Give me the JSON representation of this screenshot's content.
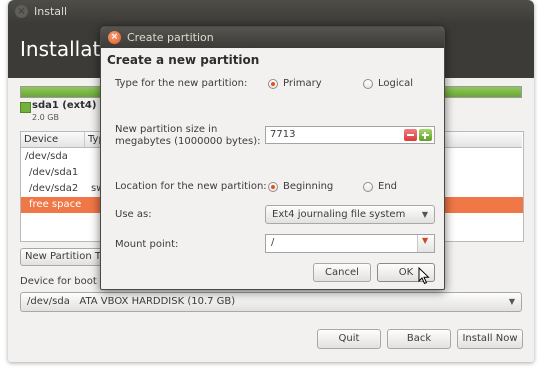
{
  "main_window": {
    "title": "Install",
    "heading": "Installation type",
    "disk": {
      "name": "sda1 (ext4)",
      "size": "2.0 GB",
      "used_fraction": 1.0
    },
    "table": {
      "columns": [
        "Device",
        "Type"
      ],
      "rows": [
        {
          "device": "/dev/sda",
          "type": ""
        },
        {
          "device": "/dev/sda1",
          "type": ""
        },
        {
          "device": "/dev/sda2",
          "type": "swap"
        },
        {
          "device": "free space",
          "type": "",
          "selected": true
        }
      ]
    },
    "new_partition_table_label": "New Partition Table...",
    "boot_loader_label": "Device for boot loader installation:",
    "boot_device": "/dev/sda   ATA VBOX HARDDISK (10.7 GB)",
    "buttons": {
      "quit": "Quit",
      "back": "Back",
      "install_now": "Install Now"
    }
  },
  "dialog": {
    "title": "Create partition",
    "heading": "Create a new partition",
    "type_label": "Type for the new partition:",
    "type_options": [
      "Primary",
      "Logical"
    ],
    "type_selected": "Primary",
    "size_label_line1": "New partition size in",
    "size_label_line2": "megabytes (1000000 bytes):",
    "size_value": "7713",
    "location_label": "Location for the new partition:",
    "location_options": [
      "Beginning",
      "End"
    ],
    "location_selected": "Beginning",
    "use_as_label": "Use as:",
    "use_as_value": "Ext4 journaling file system",
    "mount_label": "Mount point:",
    "mount_value": "/",
    "cancel": "Cancel",
    "ok": "OK"
  },
  "colors": {
    "accent": "#e2521d",
    "selection": "#f07746",
    "titlebar": "#3c3b37",
    "disk_bar": "#73b03f"
  },
  "icons": {
    "dropdown": "▼",
    "close": "×",
    "cursor": "mouse-pointer-icon"
  }
}
